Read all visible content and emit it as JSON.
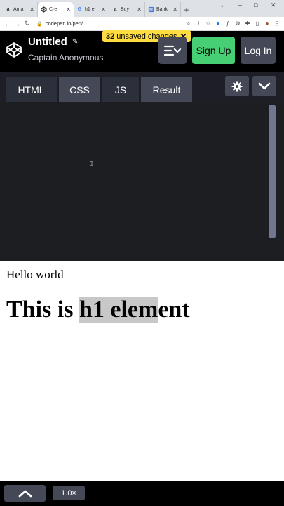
{
  "browser": {
    "tabs": [
      {
        "favicon": "a",
        "title": "Ama",
        "active": false
      },
      {
        "favicon": "codepen-icon",
        "title": "Cre",
        "active": true
      },
      {
        "favicon": "G",
        "title": "h1 el",
        "active": false
      },
      {
        "favicon": "a",
        "title": "Buy",
        "active": false
      },
      {
        "favicon": "doc-icon",
        "title": "Bank",
        "active": false
      }
    ],
    "new_tab": "+",
    "url": "codepen.io/pen/"
  },
  "header": {
    "pen_title": "Untitled",
    "author": "Captain Anonymous",
    "unsaved_count": "32",
    "unsaved_text": "unsaved changes",
    "signup_label": "Sign Up",
    "login_label": "Log In"
  },
  "editor_tabs": [
    {
      "label": "HTML"
    },
    {
      "label": "CSS"
    },
    {
      "label": "JS"
    },
    {
      "label": "Result"
    }
  ],
  "result": {
    "paragraph": "Hello world",
    "heading_before": "This is ",
    "heading_selected": "h1 elem",
    "heading_after": "ent"
  },
  "footer": {
    "zoom": "1.0×"
  },
  "colors": {
    "brand_green": "#47cf73",
    "unsaved_yellow": "#ffdd40",
    "button_gray": "#444857"
  }
}
